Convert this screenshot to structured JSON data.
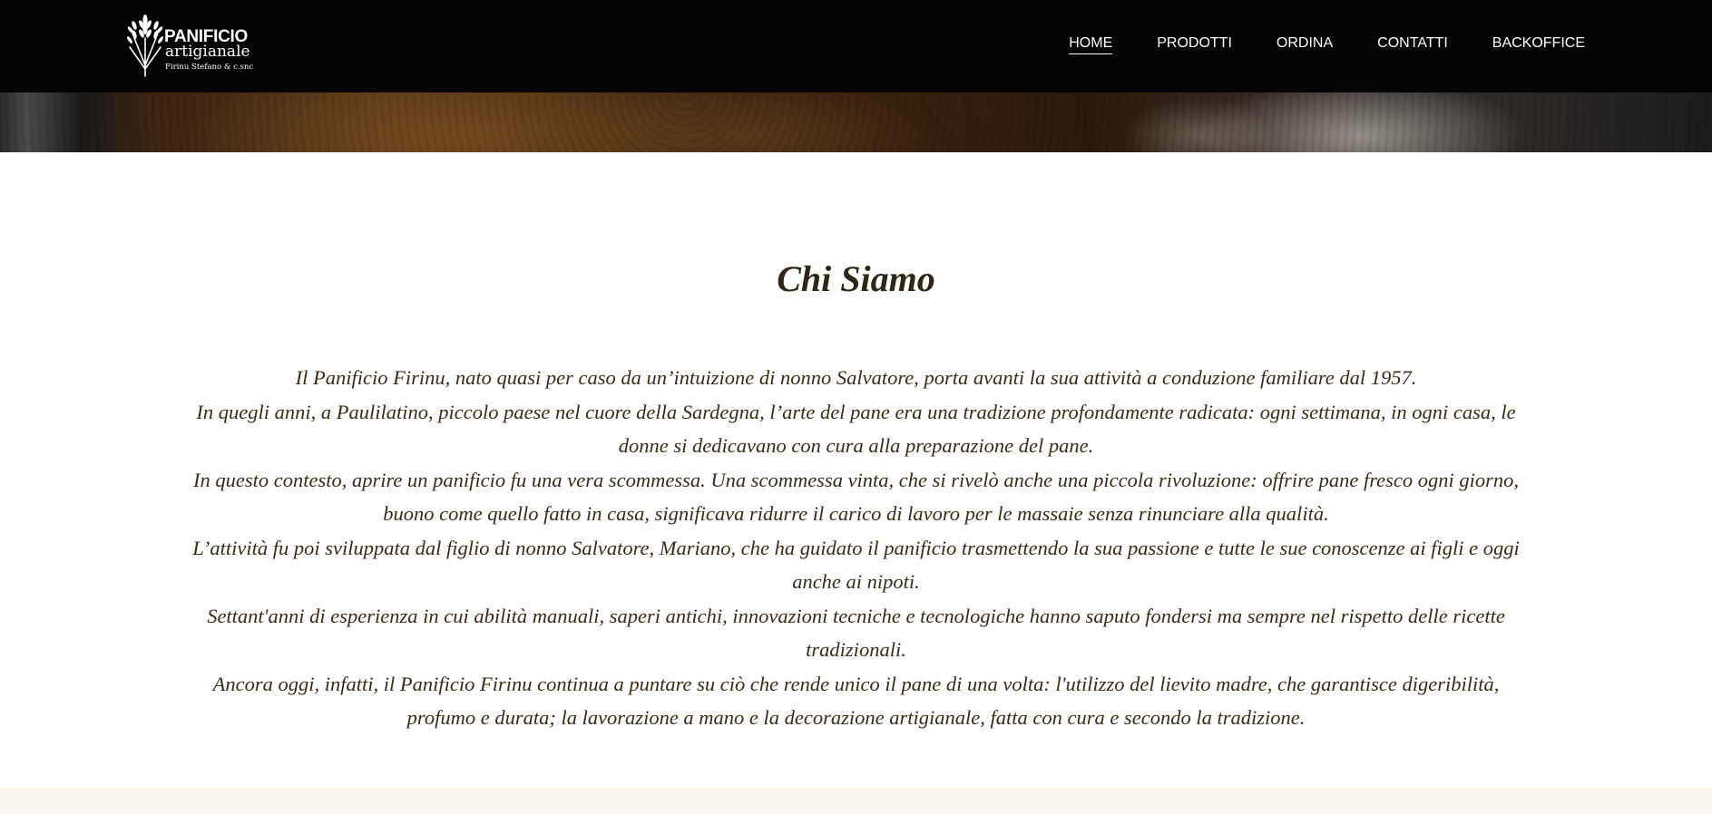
{
  "brand": {
    "logo_icon": "wheat-icon",
    "name_line1": "PANIFICIO",
    "name_line2": "artigianale",
    "name_line3": "Firinu Stefano & c.snc"
  },
  "nav": {
    "items": [
      {
        "label": "HOME",
        "active": true
      },
      {
        "label": "PRODOTTI",
        "active": false
      },
      {
        "label": "ORDINA",
        "active": false
      },
      {
        "label": "CONTATTI",
        "active": false
      },
      {
        "label": "BACKOFFICE",
        "active": false
      }
    ]
  },
  "about": {
    "title": "Chi Siamo",
    "paragraphs": [
      "Il Panificio Firinu, nato quasi per caso da un’intuizione di nonno Salvatore, porta avanti la sua attività a conduzione familiare dal 1957.",
      "In quegli anni, a Paulilatino, piccolo paese nel cuore della Sardegna, l’arte del pane era una tradizione profondamente radicata: ogni settimana, in ogni casa, le donne si dedicavano con cura alla preparazione del pane.",
      "In questo contesto, aprire un panificio fu una vera scommessa. Una scommessa vinta, che si rivelò anche una piccola rivoluzione: offrire pane fresco ogni giorno, buono come quello fatto in casa, significava ridurre il carico di lavoro per le massaie senza rinunciare alla qualità.",
      "L’attività fu poi sviluppata dal figlio di nonno Salvatore, Mariano, che ha guidato il panificio trasmettendo la sua passione e tutte le sue conoscenze ai figli e oggi anche ai nipoti.",
      "Settant'anni di esperienza in cui abilità manuali, saperi antichi, innovazioni tecniche e tecnologiche hanno saputo fondersi ma sempre nel rispetto delle ricette tradizionali.",
      "Ancora oggi, infatti, il Panificio Firinu continua a puntare su ciò che rende unico il pane di una volta: l'utilizzo del lievito madre, che garantisce digeribilità, profumo e durata; la lavorazione a mano e la decorazione artigianale, fatta con cura e secondo la tradizione."
    ]
  },
  "colors": {
    "navbar_bg": "#020202",
    "title_text": "#2e2718",
    "body_text": "#3a2d18",
    "footer_band": "#fbf5ef"
  }
}
